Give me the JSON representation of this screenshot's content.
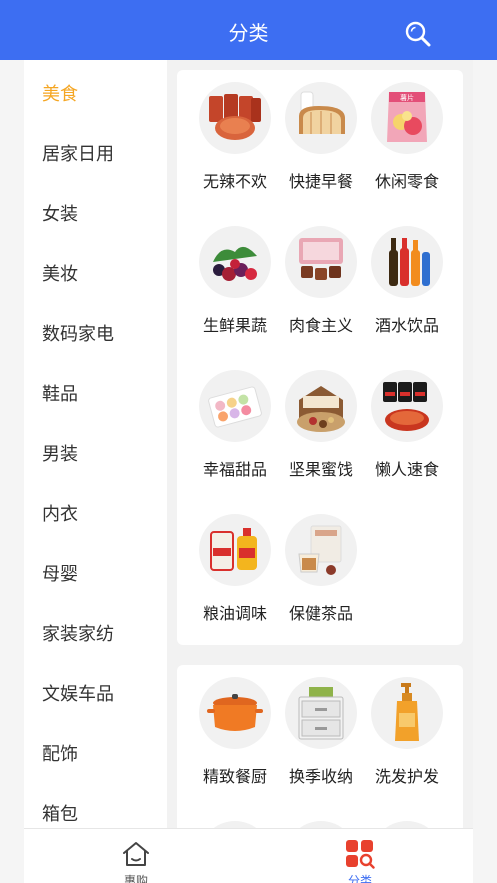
{
  "header": {
    "title": "分类",
    "search_icon": "search-icon"
  },
  "sidebar": {
    "active_index": 0,
    "items": [
      {
        "label": "美食"
      },
      {
        "label": "居家日用"
      },
      {
        "label": "女装"
      },
      {
        "label": "美妆"
      },
      {
        "label": "数码家电"
      },
      {
        "label": "鞋品"
      },
      {
        "label": "男装"
      },
      {
        "label": "内衣"
      },
      {
        "label": "母婴"
      },
      {
        "label": "家装家纺"
      },
      {
        "label": "文娱车品"
      },
      {
        "label": "配饰"
      },
      {
        "label": "箱包"
      }
    ]
  },
  "sections": [
    {
      "items": [
        {
          "label": "无辣不欢",
          "icon": "spicy-snacks-image"
        },
        {
          "label": "快捷早餐",
          "icon": "bread-milk-image"
        },
        {
          "label": "休闲零食",
          "icon": "snack-bag-image"
        },
        {
          "label": "生鲜果蔬",
          "icon": "fresh-berries-image"
        },
        {
          "label": "肉食主义",
          "icon": "braised-meat-image"
        },
        {
          "label": "酒水饮品",
          "icon": "drink-bottles-image"
        },
        {
          "label": "幸福甜品",
          "icon": "macarons-image"
        },
        {
          "label": "坚果蜜饯",
          "icon": "nuts-box-image"
        },
        {
          "label": "懒人速食",
          "icon": "instant-noodles-image"
        },
        {
          "label": "粮油调味",
          "icon": "rice-oil-image"
        },
        {
          "label": "保健茶品",
          "icon": "health-tea-image"
        }
      ]
    },
    {
      "items": [
        {
          "label": "精致餐厨",
          "icon": "orange-pot-image"
        },
        {
          "label": "换季收纳",
          "icon": "storage-drawer-image"
        },
        {
          "label": "洗发护发",
          "icon": "shampoo-bottle-image"
        }
      ]
    }
  ],
  "tabbar": {
    "active_index": 1,
    "tabs": [
      {
        "label": "惠购",
        "icon": "home-icon"
      },
      {
        "label": "分类",
        "icon": "category-grid-icon"
      }
    ]
  },
  "colors": {
    "primary": "#3d6ef2",
    "active_category": "#f5a623",
    "text": "#333333"
  }
}
